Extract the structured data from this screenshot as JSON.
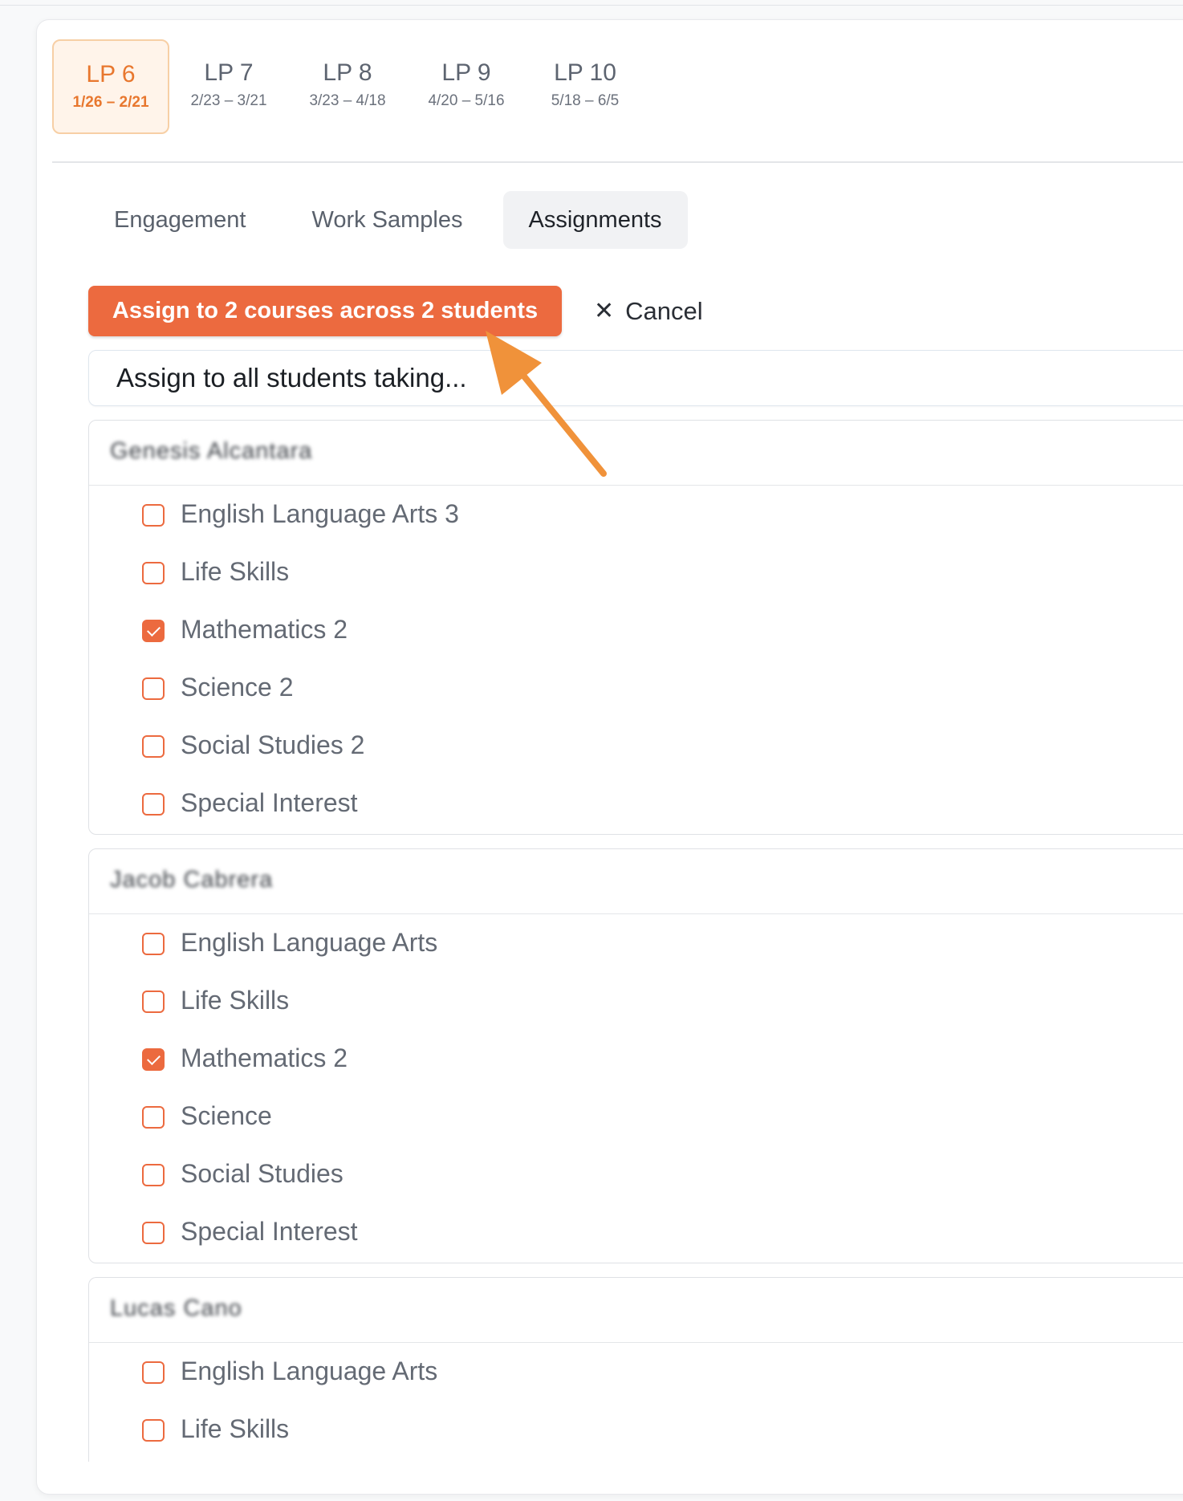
{
  "periods": [
    {
      "label": "LP 6",
      "range": "1/26 – 2/21",
      "active": true
    },
    {
      "label": "LP 7",
      "range": "2/23 – 3/21",
      "active": false
    },
    {
      "label": "LP 8",
      "range": "3/23 – 4/18",
      "active": false
    },
    {
      "label": "LP 9",
      "range": "4/20 – 5/16",
      "active": false
    },
    {
      "label": "LP 10",
      "range": "5/18 – 6/5",
      "active": false
    }
  ],
  "tabs": [
    {
      "label": "Engagement",
      "active": false
    },
    {
      "label": "Work Samples",
      "active": false
    },
    {
      "label": "Assignments",
      "active": true
    }
  ],
  "actions": {
    "assign_label": "Assign to 2 courses across 2 students",
    "cancel_label": "Cancel"
  },
  "assign_all": {
    "placeholder": "Assign to all students taking..."
  },
  "students": [
    {
      "name": "Genesis Alcantara",
      "courses": [
        {
          "label": "English Language Arts 3",
          "checked": false
        },
        {
          "label": "Life Skills",
          "checked": false
        },
        {
          "label": "Mathematics 2",
          "checked": true
        },
        {
          "label": "Science 2",
          "checked": false
        },
        {
          "label": "Social Studies 2",
          "checked": false
        },
        {
          "label": "Special Interest",
          "checked": false
        }
      ]
    },
    {
      "name": "Jacob Cabrera",
      "courses": [
        {
          "label": "English Language Arts",
          "checked": false
        },
        {
          "label": "Life Skills",
          "checked": false
        },
        {
          "label": "Mathematics 2",
          "checked": true
        },
        {
          "label": "Science",
          "checked": false
        },
        {
          "label": "Social Studies",
          "checked": false
        },
        {
          "label": "Special Interest",
          "checked": false
        }
      ]
    },
    {
      "name": "Lucas Cano",
      "courses": [
        {
          "label": "English Language Arts",
          "checked": false
        },
        {
          "label": "Life Skills",
          "checked": false
        }
      ]
    }
  ],
  "colors": {
    "accent": "#ec6a3f",
    "period_active": "#e8772e",
    "annotation_arrow": "#f0923a"
  }
}
